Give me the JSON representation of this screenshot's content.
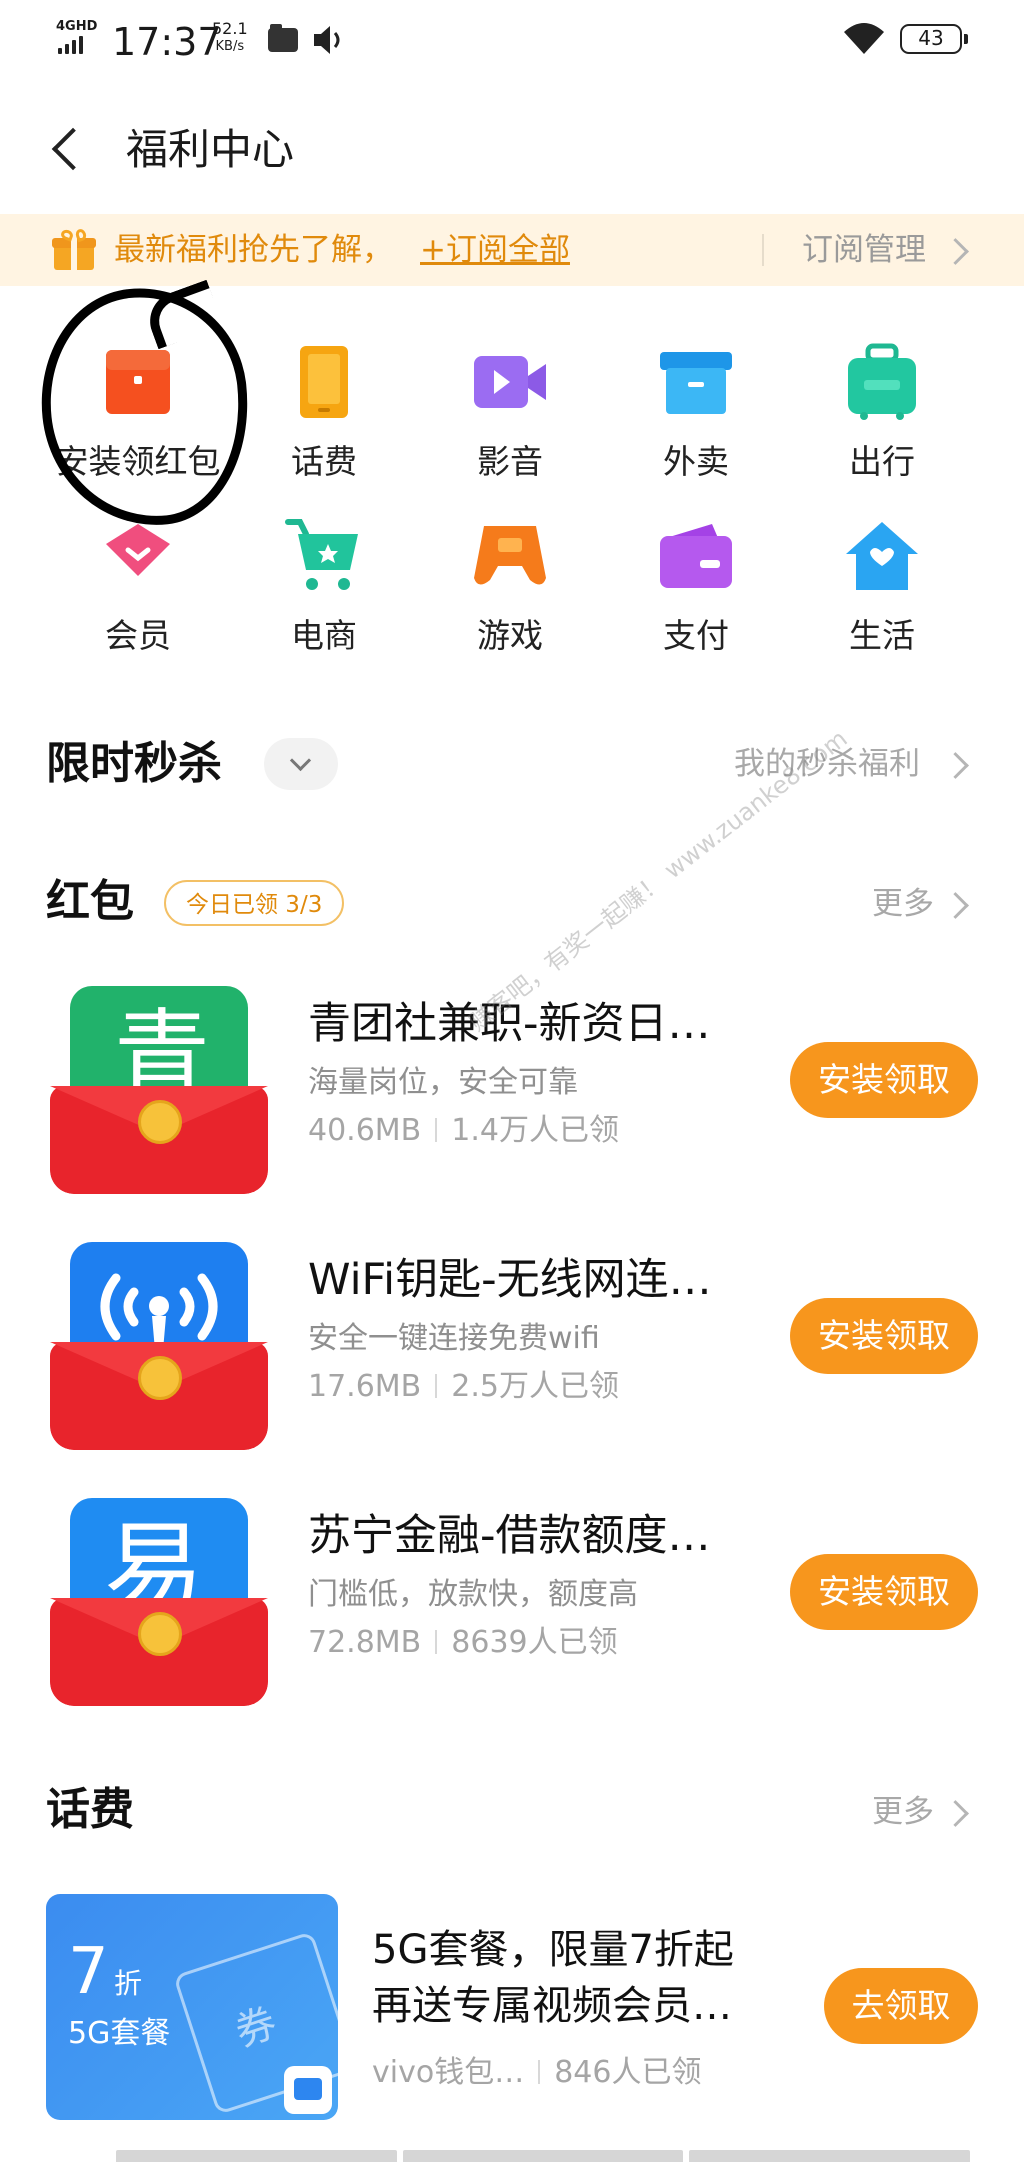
{
  "status_bar": {
    "network": "4GHD",
    "time": "17:37",
    "speed": "52.1",
    "speed_unit": "KB/s",
    "battery": "43"
  },
  "header": {
    "title": "福利中心"
  },
  "banner": {
    "text": "最新福利抢先了解，",
    "link": "+订阅全部",
    "manage": "订阅管理"
  },
  "categories": [
    {
      "label": "安装领红包",
      "icon": "red-envelope-icon",
      "color": "#f5501f"
    },
    {
      "label": "话费",
      "icon": "phone-icon",
      "color": "#f6a511"
    },
    {
      "label": "影音",
      "icon": "video-camera-icon",
      "color": "#9b6cf2"
    },
    {
      "label": "外卖",
      "icon": "takeout-box-icon",
      "color": "#28a8ef"
    },
    {
      "label": "出行",
      "icon": "luggage-icon",
      "color": "#22c7a0"
    },
    {
      "label": "会员",
      "icon": "diamond-icon",
      "color": "#f04e7e"
    },
    {
      "label": "电商",
      "icon": "shopping-cart-icon",
      "color": "#21c49c"
    },
    {
      "label": "游戏",
      "icon": "gamepad-icon",
      "color": "#f57b1b"
    },
    {
      "label": "支付",
      "icon": "wallet-icon",
      "color": "#b559ee"
    },
    {
      "label": "生活",
      "icon": "house-icon",
      "color": "#2aa5f2"
    }
  ],
  "flash_sale": {
    "title": "限时秒杀",
    "more": "我的秒杀福利"
  },
  "red_packets": {
    "title": "红包",
    "badge": "今日已领 3/3",
    "more": "更多",
    "apps": [
      {
        "name": "青团社兼职-新资日…",
        "desc": "海量岗位，安全可靠",
        "size": "40.6MB",
        "count": "1.4万人已领",
        "button": "安装领取",
        "icon": "qingtuanshe-icon",
        "char": "青",
        "color": "#21b26b"
      },
      {
        "name": "WiFi钥匙-无线网连…",
        "desc": "安全一键连接免费wifi",
        "size": "17.6MB",
        "count": "2.5万人已领",
        "button": "安装领取",
        "icon": "wifi-key-icon",
        "char": "",
        "color": "#1e7ff0"
      },
      {
        "name": "苏宁金融-借款额度…",
        "desc": "门槛低，放款快，额度高",
        "size": "72.8MB",
        "count": "8639人已领",
        "button": "安装领取",
        "icon": "suning-finance-icon",
        "char": "易",
        "color": "#1f8cf2"
      }
    ]
  },
  "phone_bill": {
    "title": "话费",
    "more": "更多",
    "card_num": "7",
    "card_zhe": "折",
    "card_5g": "5G套餐",
    "card_quan": "券",
    "offer_title": "5G套餐，限量7折起再送专属视频会员…",
    "source": "vivo钱包…",
    "count": "846人已领",
    "button": "去领取"
  },
  "watermark": "赚客吧，有奖一起赚！ www.zuanke8.com"
}
